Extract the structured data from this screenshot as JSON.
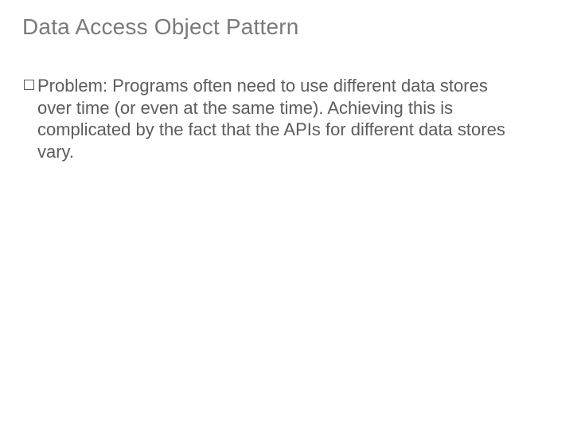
{
  "title": "Data Access Object Pattern",
  "bullet": {
    "label": "Problem:",
    "text": "  Programs often need to use different data stores over time (or even at the same time).  Achieving this is complicated by the fact that the APIs for different data stores vary."
  }
}
